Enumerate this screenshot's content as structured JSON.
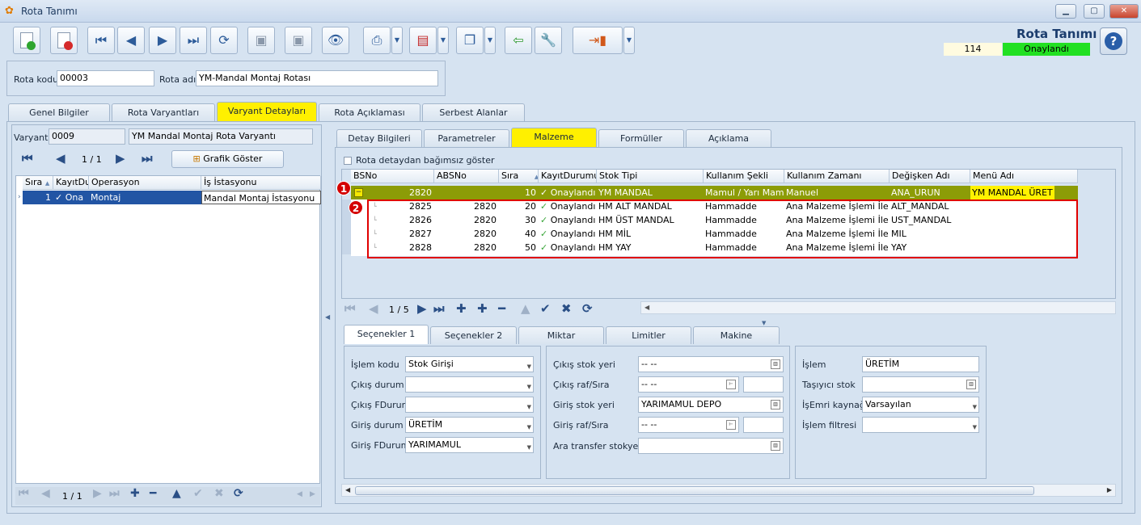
{
  "window": {
    "title": "Rota Tanımı"
  },
  "header": {
    "title": "Rota Tanımı",
    "record_number": "114",
    "status": "Onaylandı"
  },
  "form": {
    "rota_kodu_label": "Rota kodu",
    "rota_kodu": "00003",
    "rota_adi_label": "Rota adı",
    "rota_adi": "YM-Mandal Montaj Rotası"
  },
  "main_tabs": [
    "Genel Bilgiler",
    "Rota Varyantları",
    "Varyant Detayları",
    "Rota Açıklaması",
    "Serbest Alanlar"
  ],
  "left": {
    "variant_label": "Varyant",
    "variant_code": "0009",
    "variant_name": "YM Mandal Montaj Rota Varyantı",
    "nav_page": "1 / 1",
    "graph_button": "Grafik Göster",
    "columns": [
      "Sıra",
      "KayıtDur",
      "Operasyon",
      "İş İstasyonu"
    ],
    "row": {
      "sira": "1",
      "kayit": "Ona",
      "operasyon": "Montaj",
      "istasyon": "Mandal Montaj İstasyonu"
    },
    "bottom_page": "1 / 1"
  },
  "detail_tabs": [
    "Detay Bilgileri",
    "Parametreler",
    "Malzeme",
    "Formüller",
    "Açıklama"
  ],
  "material": {
    "independent_label": "Rota detaydan bağımsız göster",
    "columns": [
      "BSNo",
      "ABSNo",
      "Sıra",
      "KayıtDurumu",
      "Stok Tipi",
      "Kullanım Şekli",
      "Kullanım Zamanı",
      "Değişken Adı",
      "Menü Adı"
    ],
    "parent": {
      "bsno": "2820",
      "absno": "",
      "sira": "10",
      "durum": "Onaylandı",
      "stok": "YM MANDAL",
      "sekil": "Mamul / Yarı Mamul",
      "zaman": "Manuel",
      "degisken": "ANA_URUN",
      "menu": "YM MANDAL ÜRET"
    },
    "rows": [
      {
        "bsno": "2825",
        "absno": "2820",
        "sira": "20",
        "durum": "Onaylandı",
        "stok": "HM ALT MANDAL",
        "sekil": "Hammadde",
        "zaman": "Ana Malzeme İşlemi İle",
        "degisken": "ALT_MANDAL"
      },
      {
        "bsno": "2826",
        "absno": "2820",
        "sira": "30",
        "durum": "Onaylandı",
        "stok": "HM ÜST MANDAL",
        "sekil": "Hammadde",
        "zaman": "Ana Malzeme İşlemi İle",
        "degisken": "UST_MANDAL"
      },
      {
        "bsno": "2827",
        "absno": "2820",
        "sira": "40",
        "durum": "Onaylandı",
        "stok": "HM MİL",
        "sekil": "Hammadde",
        "zaman": "Ana Malzeme İşlemi İle",
        "degisken": "MIL"
      },
      {
        "bsno": "2828",
        "absno": "2820",
        "sira": "50",
        "durum": "Onaylandı",
        "stok": "HM YAY",
        "sekil": "Hammadde",
        "zaman": "Ana Malzeme İşlemi İle",
        "degisken": "YAY"
      }
    ],
    "nav_page": "1 / 5",
    "markers": [
      "1",
      "2"
    ]
  },
  "option_tabs": [
    "Seçenekler 1",
    "Seçenekler 2",
    "Miktar",
    "Limitler",
    "Makine"
  ],
  "options": {
    "col1": [
      {
        "label": "İşlem kodu",
        "value": "Stok Girişi"
      },
      {
        "label": "Çıkış durum",
        "value": ""
      },
      {
        "label": "Çıkış FDurum",
        "value": ""
      },
      {
        "label": "Giriş durum",
        "value": "ÜRETİM"
      },
      {
        "label": "Giriş FDurum",
        "value": "YARIMAMUL"
      }
    ],
    "col2": [
      {
        "label": "Çıkış stok yeri",
        "value": "-- --"
      },
      {
        "label": "Çıkış raf/Sıra",
        "value": "-- --"
      },
      {
        "label": "Giriş stok yeri",
        "value": "YARIMAMUL DEPO"
      },
      {
        "label": "Giriş raf/Sıra",
        "value": "-- --"
      },
      {
        "label": "Ara transfer stokyeri",
        "value": ""
      }
    ],
    "col3": [
      {
        "label": "İşlem",
        "value": "ÜRETİM"
      },
      {
        "label": "Taşıyıcı stok",
        "value": ""
      },
      {
        "label": "İşEmri kaynağı",
        "value": "Varsayılan"
      },
      {
        "label": "İşlem filtresi",
        "value": ""
      }
    ]
  }
}
